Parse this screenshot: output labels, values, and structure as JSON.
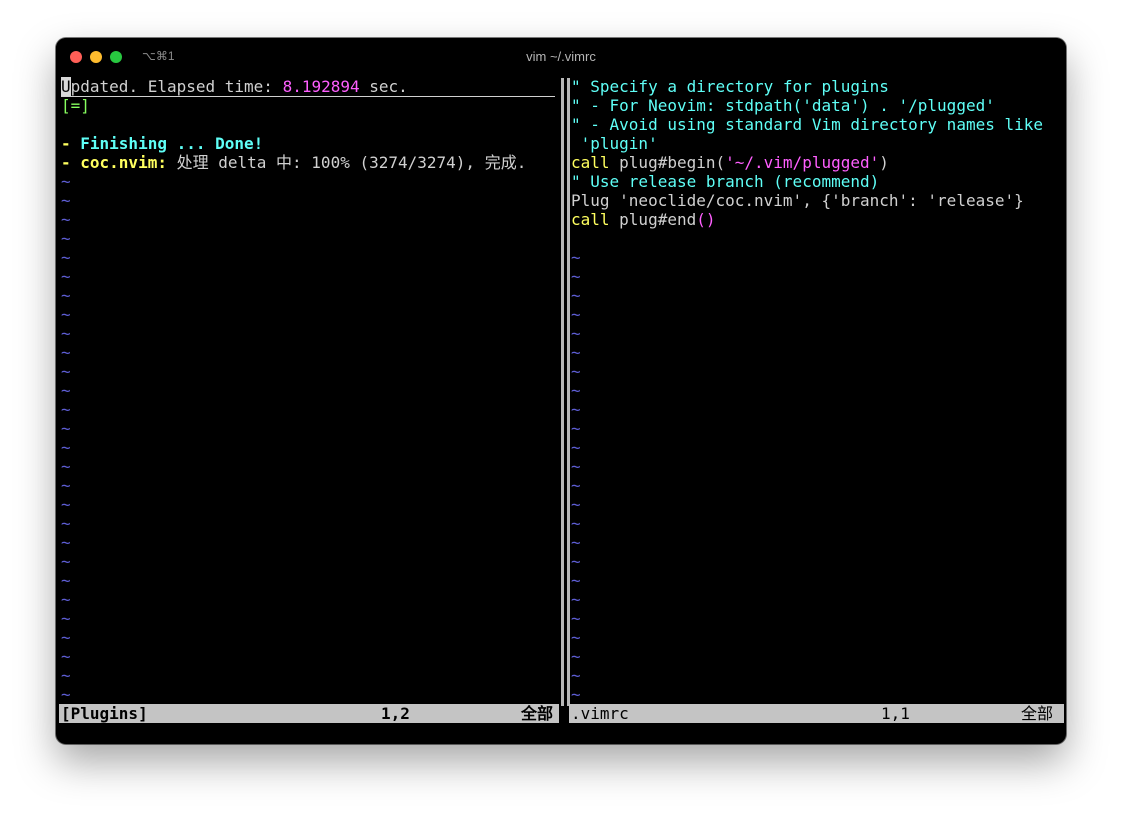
{
  "window": {
    "title": "vim ~/.vimrc",
    "shortcut": "⌥⌘1"
  },
  "left_pane": {
    "header": {
      "cursor_char": "U",
      "text_a": "pdated. Elapsed time: ",
      "elapsed": "8.192894",
      "text_b": " sec."
    },
    "progress_bar": "[=]",
    "finishing": {
      "dash": "- ",
      "text": "Finishing ... Done!"
    },
    "plugin_line": {
      "dash": "- ",
      "name": "coc.nvim:",
      "status": " 处理 delta 中: 100% (3274/3274), 完成."
    },
    "empty_marker": "~"
  },
  "right_pane": {
    "comment1": "\" Specify a directory for plugins",
    "comment2": "\" - For Neovim: stdpath('data') . '/plugged'",
    "comment3": "\" - Avoid using standard Vim directory names like",
    "comment3_wrap": " 'plugin'",
    "begin": {
      "keyword": "call",
      "func": " plug#begin(",
      "arg": "'~/.vim/plugged'",
      "close": ")"
    },
    "comment4": "\" Use release branch (recommend)",
    "plug_line": "Plug 'neoclide/coc.nvim', {'branch': 'release'}",
    "end": {
      "keyword": "call",
      "func": " plug#end",
      "parens": "()"
    },
    "empty_marker": "~"
  },
  "status_left": {
    "name": "[Plugins]",
    "position": "1,2",
    "all": "全部"
  },
  "status_right": {
    "name": ".vimrc",
    "position": "1,1",
    "all": "全部"
  },
  "colors": {
    "background": "#000000",
    "comment": "#5ffff7",
    "keyword": "#ffff5f",
    "string": "#ff5fff",
    "tilde": "#5f5fd7",
    "statusline": "#c4c4c4"
  }
}
